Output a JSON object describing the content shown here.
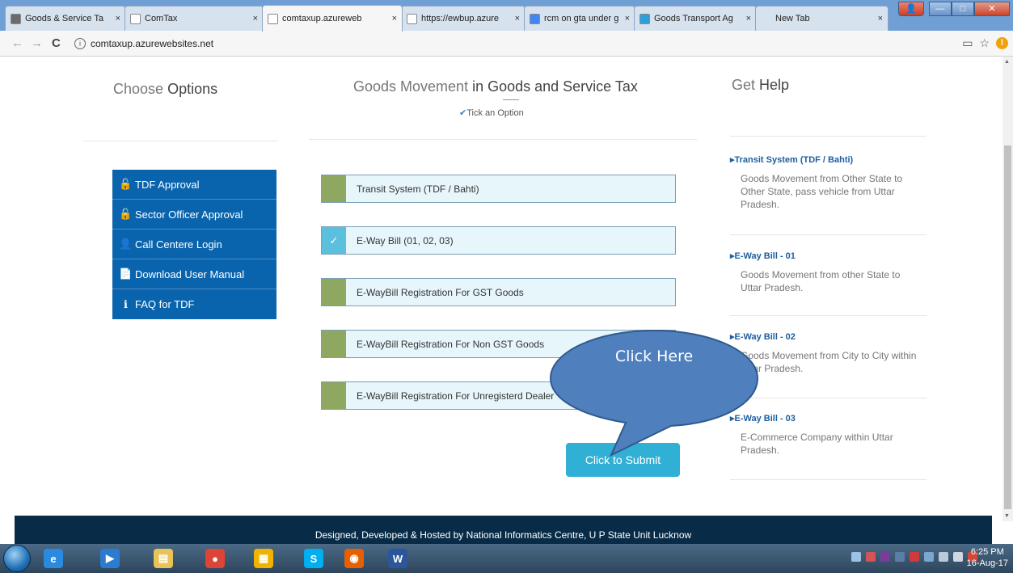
{
  "browser": {
    "tabs": [
      {
        "title": "Goods & Service Ta",
        "icon_color": "#6b6b6b",
        "active": false
      },
      {
        "title": "ComTax",
        "icon_color": "#ffffff",
        "active": false
      },
      {
        "title": "comtaxup.azureweb",
        "icon_color": "#ffffff",
        "active": true
      },
      {
        "title": "https://ewbup.azure",
        "icon_color": "#ffffff",
        "active": false
      },
      {
        "title": "rcm on gta under g",
        "icon_color": "#4285f4",
        "active": false
      },
      {
        "title": "Goods Transport Ag",
        "icon_color": "#2e9fd8",
        "active": false
      },
      {
        "title": "New Tab",
        "icon_color": "none",
        "active": false
      }
    ],
    "tab_close": "×",
    "url": "comtaxup.azurewebsites.net",
    "back_icon": "←",
    "forward_icon": "→",
    "reload_icon": "C",
    "info_icon": "i",
    "star_icon": "☆",
    "warning_icon": "!"
  },
  "left": {
    "heading_light": "Choose",
    "heading_strong": "Options",
    "menu": [
      {
        "label": "TDF Approval",
        "icon": "unlock-icon",
        "glyph": "🔓"
      },
      {
        "label": "Sector Officer Approval",
        "icon": "unlock-icon",
        "glyph": "🔓"
      },
      {
        "label": "Call Centere Login",
        "icon": "user-circle-icon",
        "glyph": "👤"
      },
      {
        "label": "Download User Manual",
        "icon": "pdf-file-icon",
        "glyph": "📄"
      },
      {
        "label": "FAQ for TDF",
        "icon": "info-circle-icon",
        "glyph": "ℹ"
      }
    ]
  },
  "center": {
    "heading_light": "Goods Movement",
    "heading_mid": " in ",
    "heading_strong": "Goods and Service Tax",
    "tick_hint": "Tick an Option",
    "tick_glyph": "✔",
    "options": [
      {
        "label": "Transit System (TDF / Bahti)",
        "checked": false
      },
      {
        "label": "E-Way Bill (01, 02, 03)",
        "checked": true
      },
      {
        "label": "E-WayBill Registration For GST Goods",
        "checked": false
      },
      {
        "label": "E-WayBill Registration For Non GST Goods",
        "checked": false
      },
      {
        "label": "E-WayBill Registration For Unregisterd Dealer",
        "checked": false
      }
    ],
    "check_glyph": "✓",
    "submit_label": "Click to Submit",
    "callout_text": "Click Here"
  },
  "right": {
    "heading_light": "Get",
    "heading_strong": "Help",
    "items": [
      {
        "title": "▸Transit System (TDF / Bahti)",
        "text": "Goods Movement from Other State to Other State, pass vehicle from Uttar Pradesh."
      },
      {
        "title": "▸E-Way Bill - 01",
        "text": "Goods Movement from other State to Uttar Pradesh."
      },
      {
        "title": "▸E-Way Bill - 02",
        "text": "Goods Movement from City to City within Uttar Pradesh."
      },
      {
        "title": "▸E-Way Bill - 03",
        "text": "E-Commerce Company within Uttar Pradesh."
      }
    ]
  },
  "footer": {
    "text": "Designed, Developed & Hosted by National Informatics Centre, U P State Unit Lucknow"
  },
  "taskbar": {
    "apps": [
      {
        "name": "internet-explorer-icon",
        "glyph": "e",
        "color": "#2a8ae0"
      },
      {
        "name": "media-center-icon",
        "glyph": "▶",
        "color": "#2b7bd0"
      },
      {
        "name": "file-explorer-icon",
        "glyph": "▤",
        "color": "#e9c35a"
      },
      {
        "name": "chrome-icon",
        "glyph": "●",
        "color": "#db4437"
      },
      {
        "name": "tiles-app-icon",
        "glyph": "▦",
        "color": "#f0b400"
      },
      {
        "name": "skype-icon",
        "glyph": "S",
        "color": "#00aff0"
      },
      {
        "name": "firefox-icon",
        "glyph": "◉",
        "color": "#e66000"
      },
      {
        "name": "word-icon",
        "glyph": "W",
        "color": "#2b579a"
      }
    ],
    "time": "6:25 PM",
    "date": "16-Aug-17"
  },
  "colors": {
    "menu_bg": "#0a64ad",
    "option_box": "#8fa861",
    "option_checked": "#5bc0de",
    "submit_bg": "#31b0d5",
    "callout_fill": "#4f7fbd",
    "footer_bg": "#082c47",
    "help_link": "#1d5fa0"
  }
}
